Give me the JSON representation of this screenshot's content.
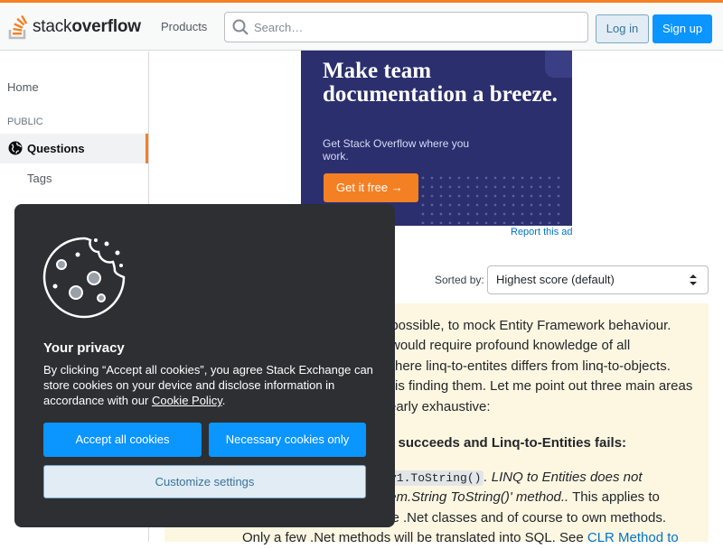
{
  "header": {
    "logo_prefix": "stack",
    "logo_suffix": "overflow",
    "products_label": "Products",
    "search_placeholder": "Search…",
    "login_label": "Log in",
    "signup_label": "Sign up"
  },
  "sidebar": {
    "home_label": "Home",
    "section_public": "PUBLIC",
    "questions_label": "Questions",
    "tags_label": "Tags"
  },
  "ad": {
    "headline": "Make team documentation a breeze.",
    "subtext": "Get Stack Overflow where you work.",
    "cta_label": "Get it free →",
    "report_label": "Report this ad"
  },
  "sort": {
    "label": "Sorted by:",
    "selected": "Highest score (default)"
  },
  "answer": {
    "line1": "npossible, to mock Entity Framework behaviour.",
    "line2": "would require profound knowledge of all",
    "line3": "here linq-to-entites differs from linq-to-objects.",
    "line4": "is finding them. Let me point out three main areas",
    "line5": "early exhaustive:",
    "heading": "s succeeds and Linq-to-Entities fails:",
    "code1": "y1.ToString()",
    "line6_italic": ". LINQ to Entities does not",
    "line7_italic": "tem.String ToString()' method..",
    "line7_rest": " This applies to",
    "line8": "ve .Net classes and of course to own methods.",
    "line9": "Only a few .Net methods will be translated into SQL. See ",
    "line9_link": "CLR Method to"
  },
  "consent": {
    "title": "Your privacy",
    "description_before_link": "By clicking “Accept all cookies”, you agree Stack Exchange can store cookies on your device and disclose information in accordance with our ",
    "link_text": "Cookie Policy",
    "description_after_link": ".",
    "accept_label": "Accept all cookies",
    "necessary_label": "Necessary cookies only",
    "customize_label": "Customize settings"
  },
  "colors": {
    "brand_orange": "#f48024",
    "primary_blue": "#0a95ff",
    "ad_background": "#2b2f6e",
    "consent_background": "#2d2f33"
  }
}
